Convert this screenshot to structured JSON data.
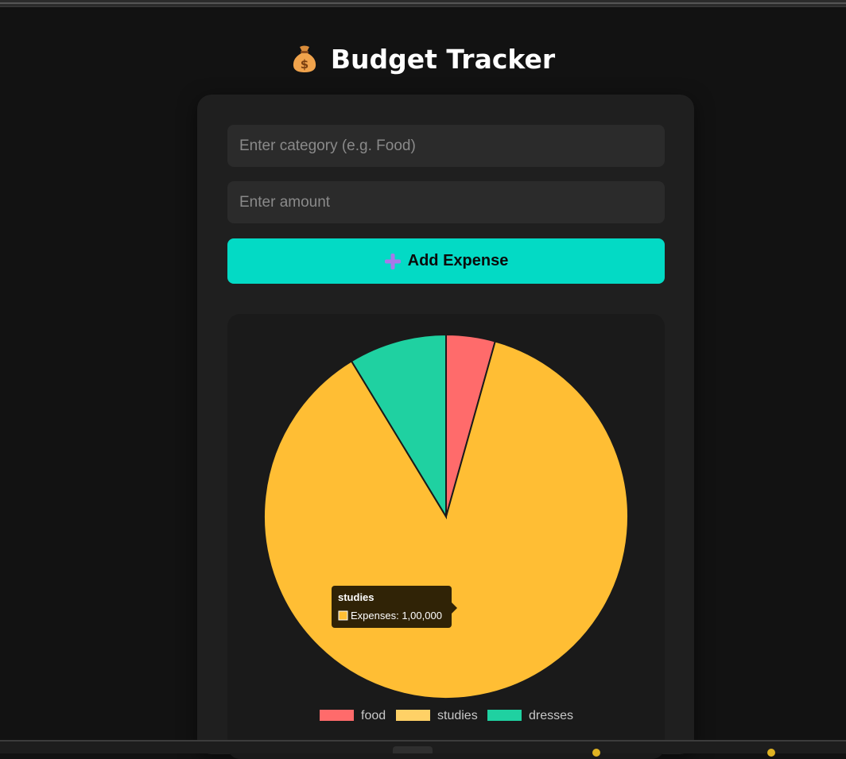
{
  "app": {
    "title": "Budget Tracker",
    "title_icon": "money-bag-icon"
  },
  "form": {
    "category_placeholder": "Enter category (e.g. Food)",
    "category_value": "",
    "amount_placeholder": "Enter amount",
    "amount_value": "",
    "add_button_label": "Add Expense",
    "add_button_icon": "plus-icon"
  },
  "colors": {
    "background": "#121212",
    "card": "#1f1f1f",
    "input": "#2b2b2b",
    "accent": "#03dac5",
    "food": "#ff6b6b",
    "studies": "#ffbe34",
    "dresses": "#1fd1a1"
  },
  "tooltip": {
    "title": "studies",
    "label": "Expenses: 1,00,000"
  },
  "chart_data": {
    "type": "pie",
    "categories": [
      "food",
      "studies",
      "dresses"
    ],
    "series": [
      {
        "name": "Expenses",
        "values": [
          5000,
          100000,
          10000
        ]
      }
    ],
    "colors": [
      "#ff6b6b",
      "#ffbe34",
      "#1fd1a1"
    ],
    "legend_colors": [
      "#ff6b6b",
      "#ffd166",
      "#1fd1a1"
    ],
    "legend": "bottom",
    "title": ""
  }
}
